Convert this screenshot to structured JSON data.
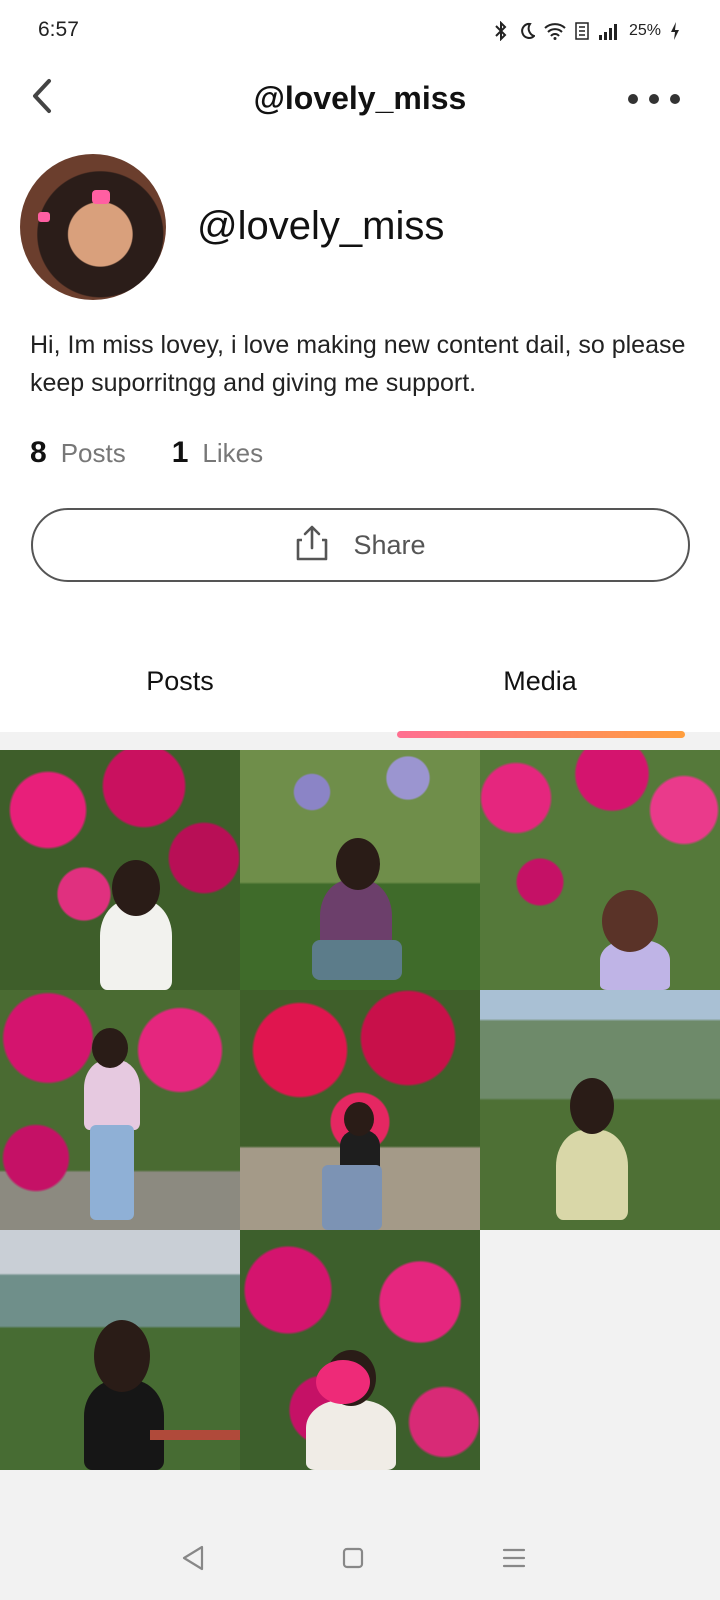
{
  "status_bar": {
    "time": "6:57",
    "battery": "25%"
  },
  "header": {
    "title": "@lovely_miss"
  },
  "profile": {
    "display_name": "@lovely_miss",
    "bio": "Hi, Im miss lovey, i love making new content dail, so please keep suporritngg and giving me support.",
    "posts_count": "8",
    "posts_label": "Posts",
    "likes_count": "1",
    "likes_label": "Likes",
    "share_label": "Share"
  },
  "tabs": [
    {
      "label": "Posts",
      "selected": false
    },
    {
      "label": "Media",
      "selected": true
    }
  ],
  "colors": {
    "tab_indicator_start": "#ff6f91",
    "tab_indicator_end": "#ff9e3d",
    "bougainvillea": "#d4146e",
    "foliage": "#3f6b2a"
  },
  "media": [
    {
      "name": "photo-1",
      "scene": "pink-flowers-girl-white-top"
    },
    {
      "name": "photo-2",
      "scene": "garden-girl-sitting"
    },
    {
      "name": "photo-3",
      "scene": "flower-arch-girl-back"
    },
    {
      "name": "photo-4",
      "scene": "pink-flowers-girl-denim"
    },
    {
      "name": "photo-5",
      "scene": "red-flowers-girl-jeans"
    },
    {
      "name": "photo-6",
      "scene": "hills-girl-kurta"
    },
    {
      "name": "photo-7",
      "scene": "hills-girl-black-top"
    },
    {
      "name": "photo-8",
      "scene": "flowers-girl-holding-flower"
    }
  ]
}
